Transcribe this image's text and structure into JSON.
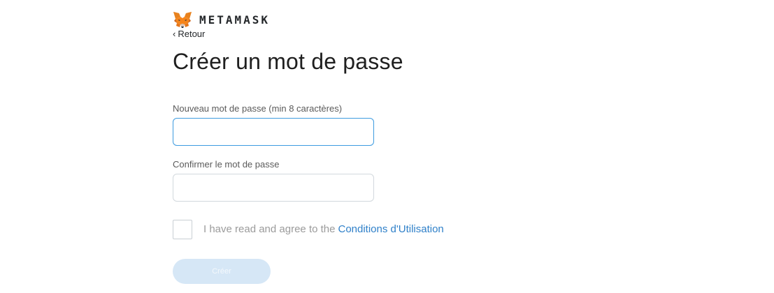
{
  "brand": {
    "name": "METAMASK",
    "logo_icon": "metamask-fox-icon"
  },
  "nav": {
    "back_label": "Retour",
    "back_icon": "chevron-left-icon"
  },
  "page": {
    "title": "Créer un mot de passe"
  },
  "form": {
    "new_password": {
      "label": "Nouveau mot de passe (min 8 caractères)",
      "value": "",
      "focused": true
    },
    "confirm_password": {
      "label": "Confirmer le mot de passe",
      "value": ""
    },
    "terms": {
      "checked": false,
      "text": "I have read and agree to the",
      "link_text": "Conditions d'Utilisation"
    },
    "submit_label": "Créer",
    "submit_enabled": false
  },
  "colors": {
    "focus_border": "#3d9be0",
    "link": "#2f80c9",
    "button_disabled_bg": "#d6e7f6"
  }
}
